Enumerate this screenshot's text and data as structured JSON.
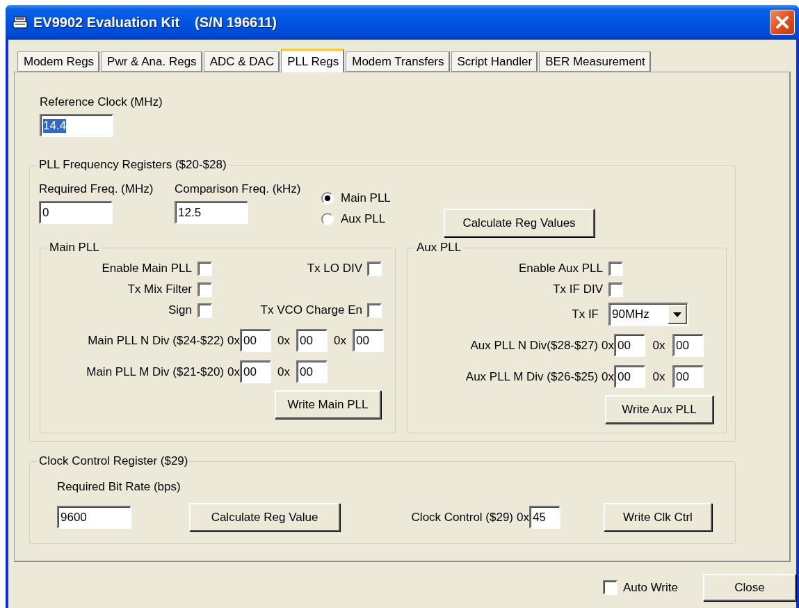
{
  "window": {
    "title": "EV9902 Evaluation Kit",
    "serial": "(S/N 196611)"
  },
  "tabs": [
    {
      "label": "Modem Regs",
      "selected": false
    },
    {
      "label": "Pwr & Ana. Regs",
      "selected": false
    },
    {
      "label": "ADC & DAC",
      "selected": false
    },
    {
      "label": "PLL Regs",
      "selected": true
    },
    {
      "label": "Modem Transfers",
      "selected": false
    },
    {
      "label": "Script Handler",
      "selected": false
    },
    {
      "label": "BER Measurement",
      "selected": false
    }
  ],
  "reference_clock": {
    "label": "Reference Clock (MHz)",
    "value": "14.4",
    "text_selected": true
  },
  "pll_frequency_registers": {
    "title": "PLL Frequency Registers ($20-$28)",
    "required_freq": {
      "label": "Required Freq. (MHz)",
      "value": "0"
    },
    "comparison_freq": {
      "label": "Comparison Freq. (kHz)",
      "value": "12.5"
    },
    "pll_choice": [
      {
        "label": "Main PLL",
        "selected": true
      },
      {
        "label": "Aux PLL",
        "selected": false
      }
    ],
    "calculate_button": "Calculate Reg Values",
    "main_pll": {
      "title": "Main PLL",
      "checkbox_rows": [
        {
          "left": {
            "label": "Enable Main PLL",
            "checked": false
          },
          "right": {
            "label": "Tx LO DIV",
            "checked": false
          }
        },
        {
          "left": {
            "label": "Tx Mix Filter",
            "checked": false
          }
        },
        {
          "left": {
            "label": "Sign",
            "checked": false
          },
          "right": {
            "label": "Tx VCO Charge En",
            "checked": false
          }
        }
      ],
      "divider_rows": [
        {
          "label": "Main PLL N Div ($24-$22)",
          "fields": [
            {
              "prefix": "0x",
              "value": "00"
            },
            {
              "prefix": "0x",
              "value": "00"
            },
            {
              "prefix": "0x",
              "value": "00"
            }
          ]
        },
        {
          "label": "Main PLL M Div ($21-$20)",
          "fields": [
            {
              "prefix": "0x",
              "value": "00"
            },
            {
              "prefix": "0x",
              "value": "00"
            }
          ]
        }
      ],
      "write_button": "Write Main PLL"
    },
    "aux_pll": {
      "title": "Aux PLL",
      "checkboxes": [
        {
          "label": "Enable Aux PLL",
          "checked": false
        },
        {
          "label": "Tx IF DIV",
          "checked": false
        }
      ],
      "tx_if": {
        "label": "Tx IF",
        "value": "90MHz"
      },
      "divider_rows": [
        {
          "label": "Aux PLL N Div($28-$27)",
          "fields": [
            {
              "prefix": "0x",
              "value": "00"
            },
            {
              "prefix": "0x",
              "value": "00"
            }
          ]
        },
        {
          "label": "Aux PLL M Div ($26-$25)",
          "fields": [
            {
              "prefix": "0x",
              "value": "00"
            },
            {
              "prefix": "0x",
              "value": "00"
            }
          ]
        }
      ],
      "write_button": "Write Aux PLL"
    }
  },
  "clock_control_register": {
    "title": "Clock Control Register ($29)",
    "bit_rate": {
      "label": "Required Bit Rate (bps)",
      "value": "9600"
    },
    "calculate_button": "Calculate Reg Value",
    "clock_control": {
      "label": "Clock Control ($29)",
      "prefix": "0x",
      "value": "45"
    },
    "write_button": "Write Clk Ctrl"
  },
  "auto_write": {
    "label": "Auto Write",
    "checked": false
  },
  "close_button": "Close"
}
